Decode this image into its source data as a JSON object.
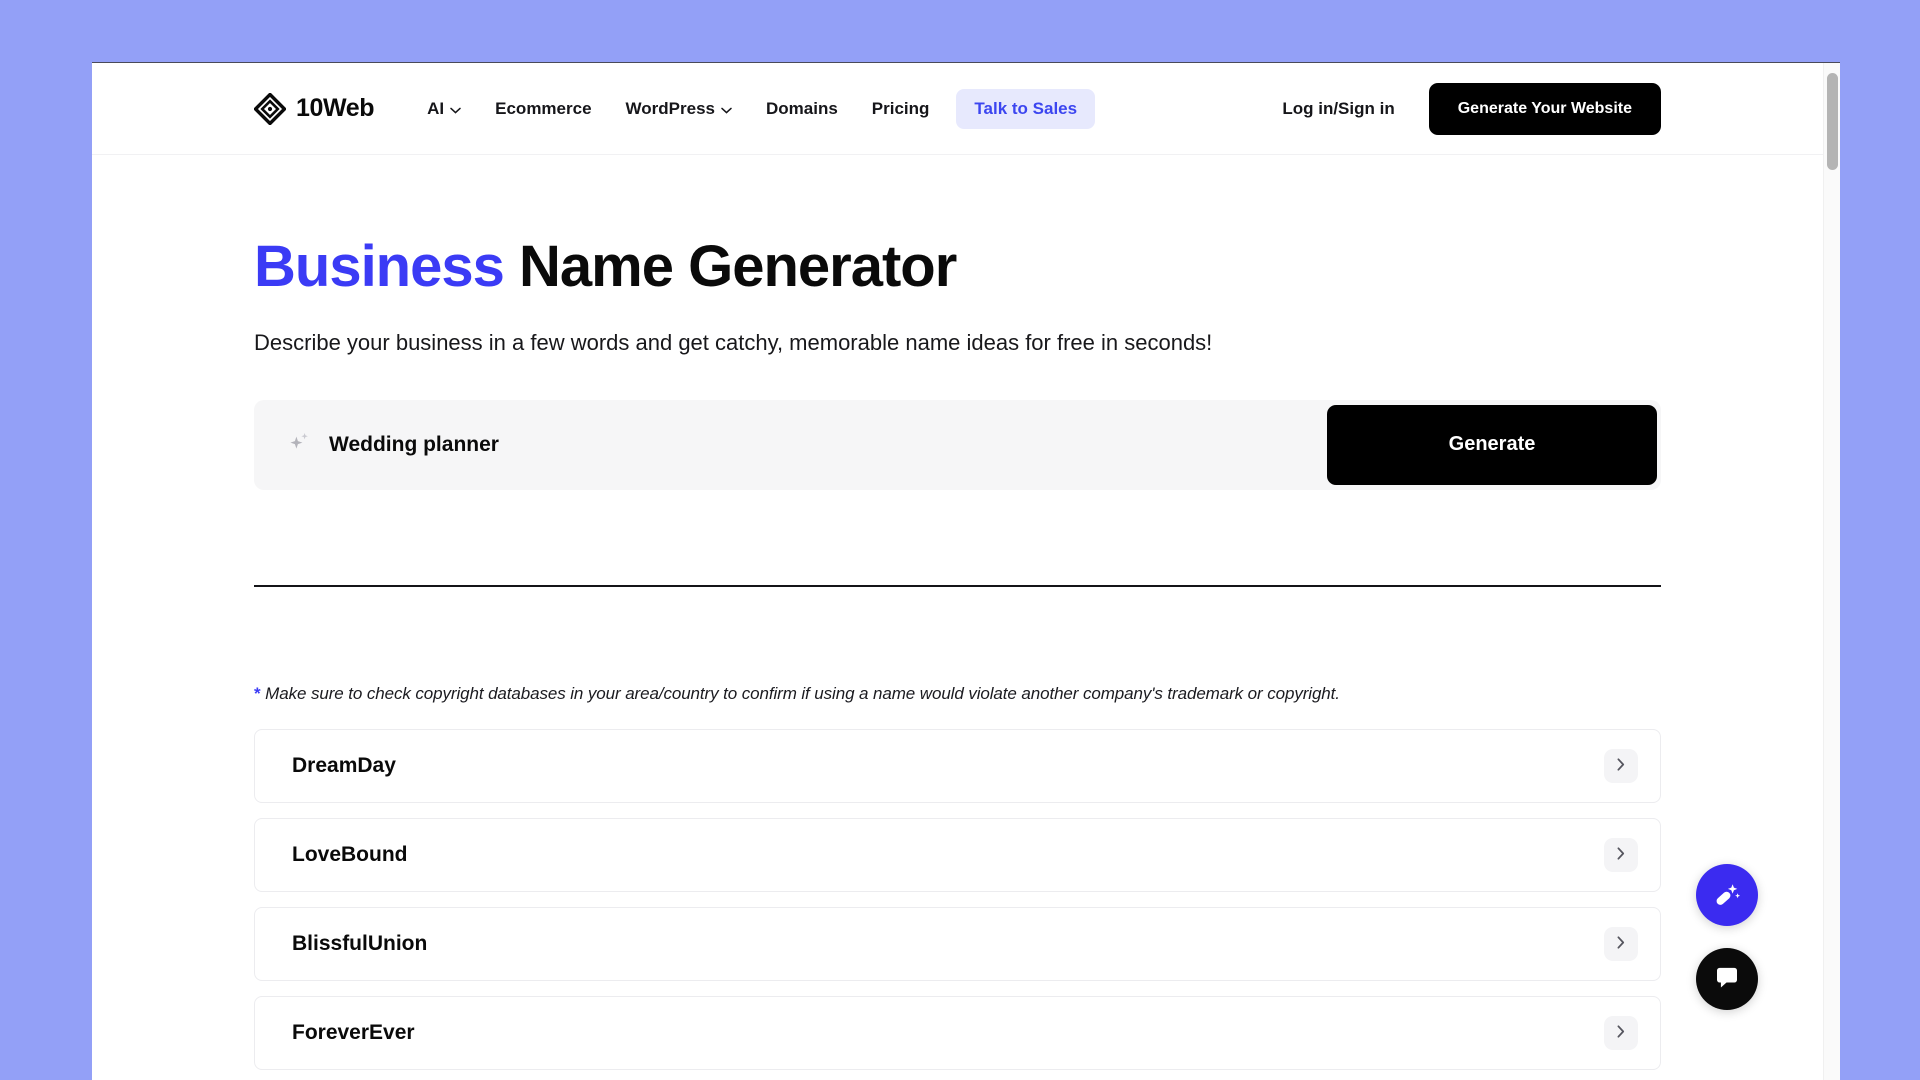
{
  "browser": {
    "background_color": "#93a0f7",
    "scrollbar": {
      "name": "vertical-scrollbar"
    }
  },
  "header": {
    "brand": {
      "name": "10Web",
      "logo_icon": "10web-diamond-logo-icon"
    },
    "nav": [
      {
        "label": "AI",
        "has_dropdown": true
      },
      {
        "label": "Ecommerce",
        "has_dropdown": false
      },
      {
        "label": "WordPress",
        "has_dropdown": true
      },
      {
        "label": "Domains",
        "has_dropdown": false
      },
      {
        "label": "Pricing",
        "has_dropdown": false
      }
    ],
    "talk_to_sales": {
      "label": "Talk to Sales",
      "color": "#3c46f0",
      "background": "#e7e9fd"
    },
    "login_label": "Log in/Sign in",
    "cta_label": "Generate Your Website"
  },
  "hero": {
    "title_accent": "Business",
    "title_rest": " Name Generator",
    "accent_color": "#3b3bf5",
    "subtitle": "Describe your business in a few words and get catchy, memorable name ideas for free in seconds!"
  },
  "prompt": {
    "icon": "sparkles-icon",
    "value": "Wedding planner",
    "placeholder": "Describe your business",
    "generate_label": "Generate"
  },
  "note": {
    "star": "*",
    "text": " Make sure to check copyright databases in your area/country to confirm if using a name would violate another company's trademark or copyright."
  },
  "results": {
    "items": [
      {
        "name": "DreamDay"
      },
      {
        "name": "LoveBound"
      },
      {
        "name": "BlissfulUnion"
      },
      {
        "name": "ForeverEver"
      }
    ],
    "expand_icon": "chevron-right-icon"
  },
  "floating_actions": [
    {
      "name": "ai-assistant-fab",
      "icon": "magic-wand-sparkle-icon",
      "color": "#3b2bf0"
    },
    {
      "name": "chat-fab",
      "icon": "chat-bubble-icon",
      "color": "#0b0b0b"
    }
  ]
}
